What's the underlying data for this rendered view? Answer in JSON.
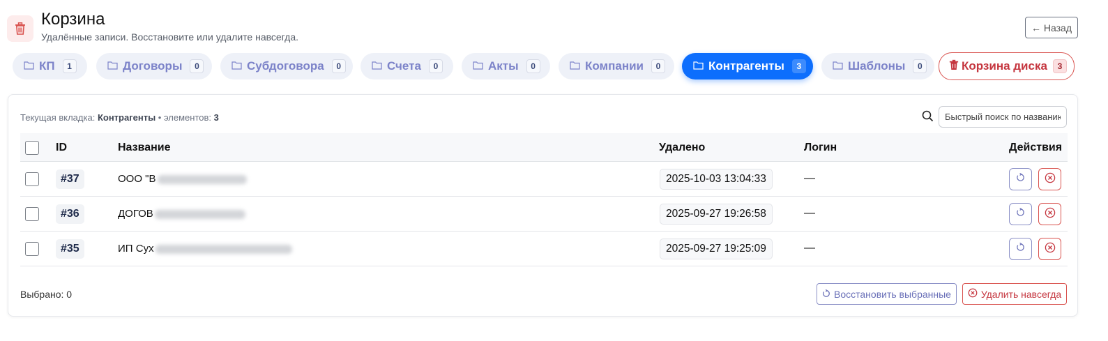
{
  "header": {
    "title": "Корзина",
    "subtitle": "Удалённые записи. Восстановите или удалите навсегда.",
    "back_label": "← Назад",
    "icon": "trash-icon"
  },
  "tabs": [
    {
      "label": "КП",
      "count": "1"
    },
    {
      "label": "Договоры",
      "count": "0"
    },
    {
      "label": "Субдоговора",
      "count": "0"
    },
    {
      "label": "Счета",
      "count": "0"
    },
    {
      "label": "Акты",
      "count": "0"
    },
    {
      "label": "Компании",
      "count": "0"
    },
    {
      "label": "Контрагенты",
      "count": "3",
      "active": true
    },
    {
      "label": "Шаблоны",
      "count": "0"
    },
    {
      "label": "Корзина диска",
      "count": "3",
      "danger": true
    }
  ],
  "info": {
    "prefix": "Текущая вкладка:",
    "tab": "Контрагенты",
    "separator": "• элементов:",
    "count": "3"
  },
  "search": {
    "placeholder": "Быстрый поиск по названию"
  },
  "table": {
    "columns": {
      "id": "ID",
      "name": "Название",
      "deleted": "Удалено",
      "login": "Логин",
      "actions": "Действия"
    },
    "rows": [
      {
        "id": "#37",
        "name": "ООО \"В",
        "deleted": "2025-10-03 13:04:33",
        "login": "—"
      },
      {
        "id": "#36",
        "name": "ДОГОВ",
        "deleted": "2025-09-27 19:26:58",
        "login": "—"
      },
      {
        "id": "#35",
        "name": "ИП Сух",
        "deleted": "2025-09-27 19:25:09",
        "login": "—"
      }
    ]
  },
  "footer": {
    "selected_label": "Выбрано: 0",
    "restore_selected": "Восстановить выбранные",
    "delete_forever": "Удалить навсегда"
  },
  "colors": {
    "accent": "#0d6efd",
    "danger": "#d9534f",
    "tab_text": "#7c83c9"
  }
}
